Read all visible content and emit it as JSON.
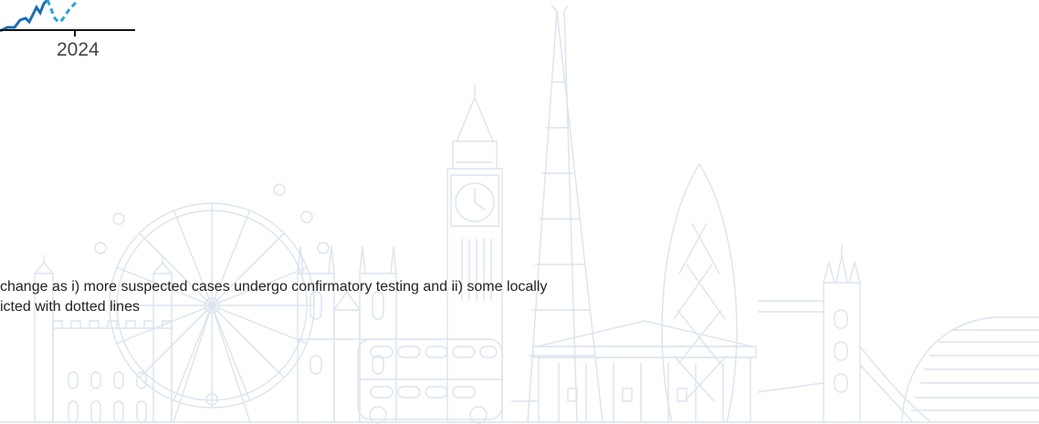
{
  "chart_fragment": {
    "year_label": "2024",
    "colors": {
      "solid_line": "#1a6fb5",
      "dotted_line": "#2aa3d8",
      "axis": "#111111"
    }
  },
  "footnote": {
    "line1": "change as i) more suspected cases undergo confirmatory testing and ii) some locally",
    "line2": "icted with dotted lines"
  },
  "background": {
    "illustration": "london-skyline-line-art",
    "stroke_color": "#dbe4ee"
  }
}
